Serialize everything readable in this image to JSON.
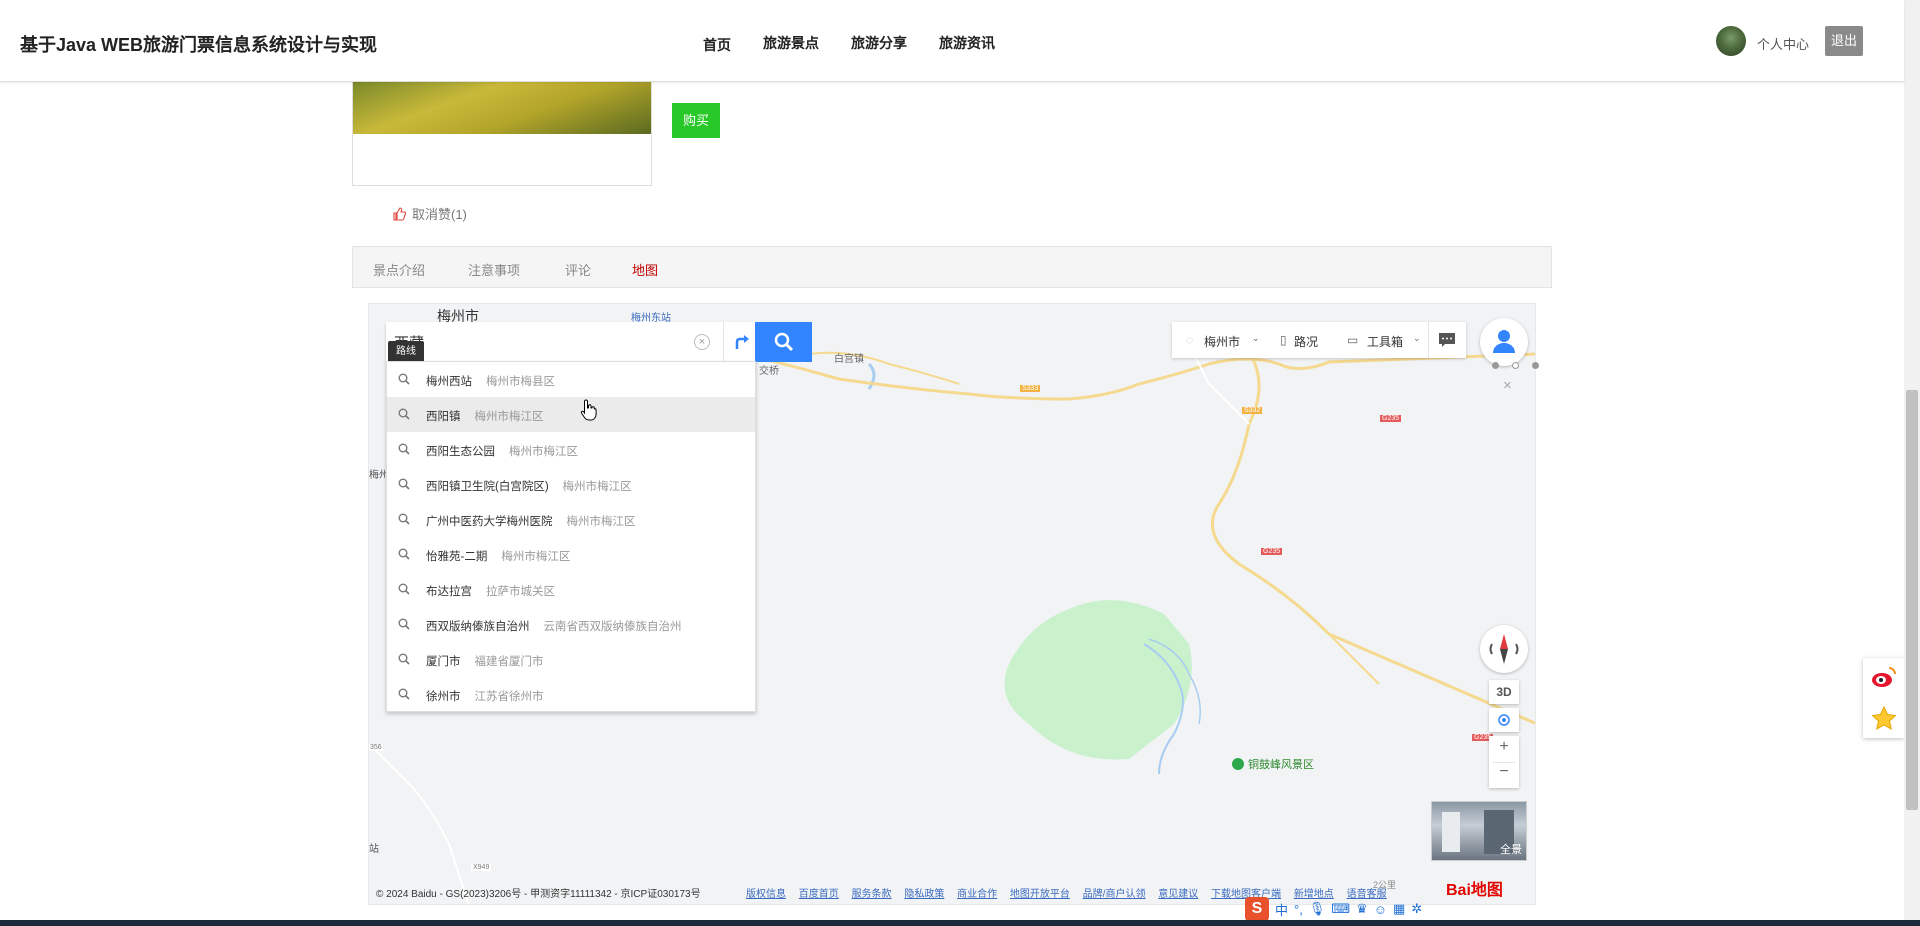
{
  "header": {
    "site_title": "基于Java WEB旅游门票信息系统设计与实现",
    "nav": [
      "首页",
      "旅游景点",
      "旅游分享",
      "旅游资讯"
    ],
    "user_center": "个人中心",
    "logout": "退出"
  },
  "detail": {
    "buy_label": "购买",
    "like_label": "取消赞(1)"
  },
  "tabs": [
    "景点介绍",
    "注意事项",
    "评论",
    "地图"
  ],
  "active_tab": "地图",
  "map": {
    "search_value": "西藏",
    "route_tooltip": "路线",
    "suggestions": [
      {
        "name": "梅州西站",
        "district": "梅州市梅县区"
      },
      {
        "name": "西阳镇",
        "district": "梅州市梅江区"
      },
      {
        "name": "西阳生态公园",
        "district": "梅州市梅江区"
      },
      {
        "name": "西阳镇卫生院(白宫院区)",
        "district": "梅州市梅江区"
      },
      {
        "name": "广州中医药大学梅州医院",
        "district": "梅州市梅江区"
      },
      {
        "name": "怡雅苑-二期",
        "district": "梅州市梅江区"
      },
      {
        "name": "布达拉宫",
        "district": "拉萨市城关区"
      },
      {
        "name": "西双版纳傣族自治州",
        "district": "云南省西双版纳傣族自治州"
      },
      {
        "name": "厦门市",
        "district": "福建省厦门市"
      },
      {
        "name": "徐州市",
        "district": "江苏省徐州市"
      }
    ],
    "city_selector": "梅州市",
    "traffic": "路况",
    "toolbox": "工具箱",
    "labels": {
      "city": "梅州市",
      "station_east": "梅州东站",
      "baigong": "白宫镇",
      "bridge": "交桥",
      "meizhou_left": "梅州",
      "scenic": "铜鼓峰风景区",
      "road_s333": "S333",
      "road_s332": "S332",
      "road_g235a": "G235",
      "road_g235b": "G235",
      "road_g235c": "G235",
      "road_356": "356",
      "road_x949": "X949",
      "station_left": "站"
    },
    "ctrl_3d": "3D",
    "zoom_in": "+",
    "zoom_out": "−",
    "panorama": "全景",
    "copyright": "© 2024 Baidu - GS(2023)3206号 - 甲测资字11111342 - 京ICP证030173号",
    "footer_links": [
      "版权信息",
      "百度首页",
      "服务条款",
      "隐私政策",
      "商业合作",
      "地图开放平台",
      "品牌/商户认领",
      "意见建议",
      "下载地图客户端",
      "新增地点",
      "语音客服"
    ],
    "scale": "2公里",
    "baidu_logo": "Bai地图"
  },
  "ime": {
    "label": "中"
  },
  "colors": {
    "buy_green": "#28c828",
    "search_blue": "#3385ff",
    "active_tab": "#c00000",
    "map_bg": "#f1f3f5",
    "scenic_green": "#c9f2cc"
  }
}
